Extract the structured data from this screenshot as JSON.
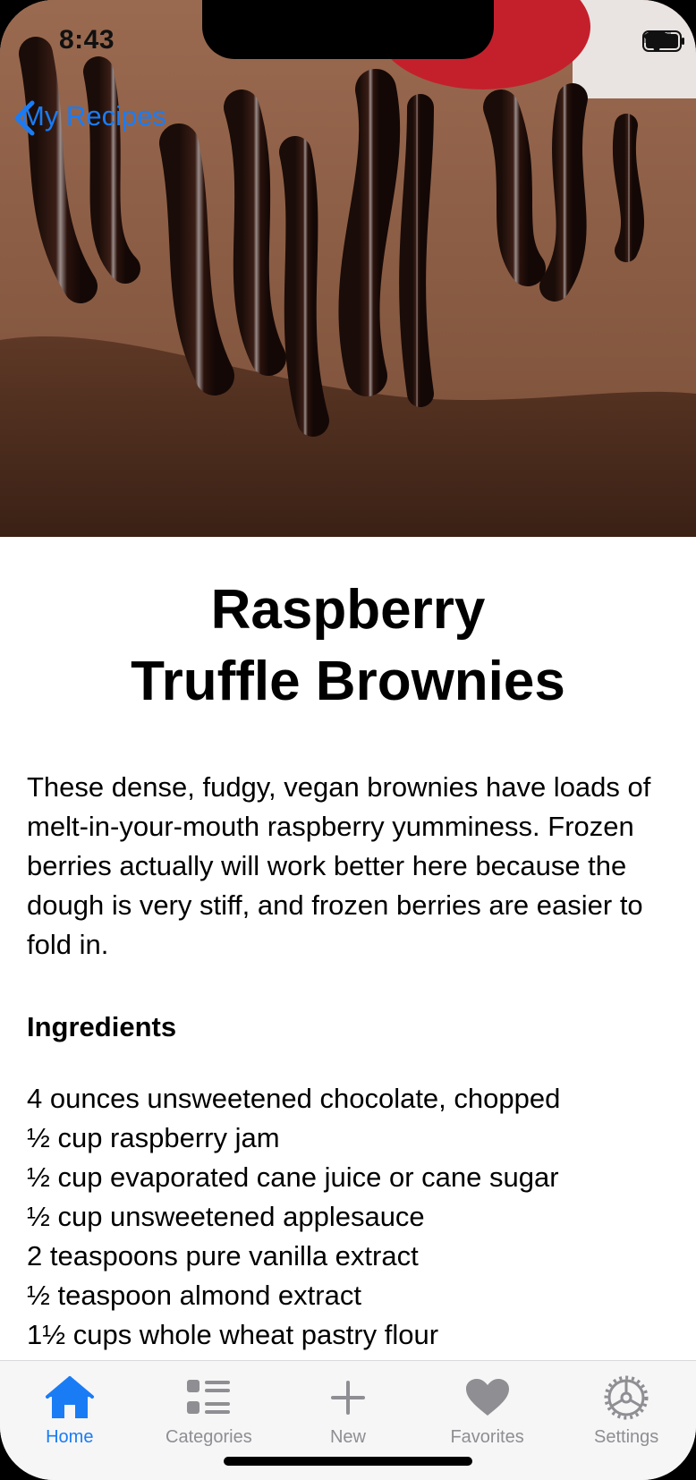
{
  "status_bar": {
    "time": "8:43"
  },
  "nav": {
    "back_label": "My Recipes"
  },
  "hero_image": {
    "alt": "brownie-with-chocolate-drizzle"
  },
  "recipe": {
    "title_line1": "Raspberry",
    "title_line2": "Truffle Brownies",
    "description": "These dense, fudgy, vegan brownies have loads of melt-in-your-mouth raspberry yumminess. Frozen berries actually will work better here because the dough is very stiff, and frozen berries are easier to fold in.",
    "ingredients_heading": "Ingredients",
    "ingredients": [
      "4 ounces unsweetened chocolate, chopped",
      "½ cup raspberry jam",
      "½ cup evaporated cane juice or cane sugar",
      "½ cup unsweetened applesauce",
      "2 teaspoons pure vanilla extract",
      "½ teaspoon almond extract",
      "1½ cups whole wheat pastry flour"
    ]
  },
  "tabbar": {
    "tabs": [
      {
        "label": "Home",
        "icon": "house-icon",
        "active": true
      },
      {
        "label": "Categories",
        "icon": "list-icon",
        "active": false
      },
      {
        "label": "New",
        "icon": "plus-icon",
        "active": false
      },
      {
        "label": "Favorites",
        "icon": "heart-icon",
        "active": false
      },
      {
        "label": "Settings",
        "icon": "gear-icon",
        "active": false
      }
    ]
  },
  "colors": {
    "accent": "#1a7cf5",
    "inactive": "#8e8e93"
  }
}
